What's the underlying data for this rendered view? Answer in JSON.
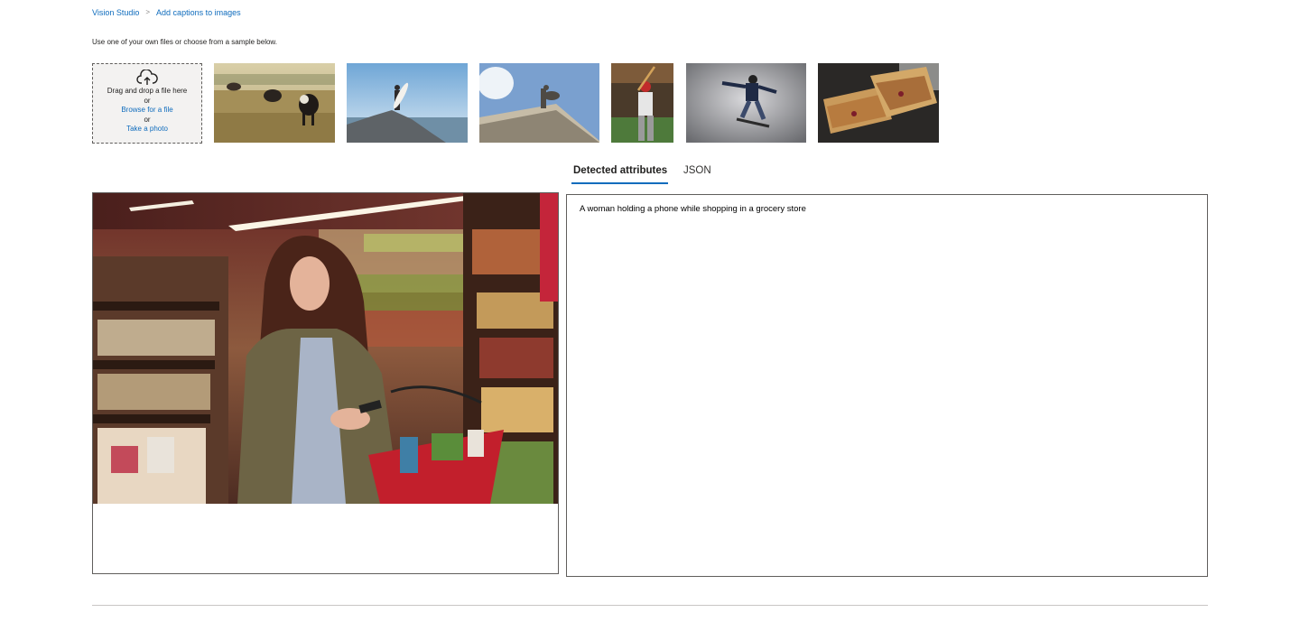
{
  "breadcrumb": {
    "root": "Vision Studio",
    "current": "Add captions to images"
  },
  "instruction": "Use one of your own files or choose from a sample below.",
  "upload": {
    "drag_text": "Drag and drop a file here",
    "or_1": "or",
    "browse_link": "Browse for a file",
    "or_2": "or",
    "photo_link": "Take a photo",
    "icon": "cloud-upload-icon"
  },
  "samples": [
    {
      "name": "cows grazing in field"
    },
    {
      "name": "surfer standing on rocks"
    },
    {
      "name": "building statue rooftop"
    },
    {
      "name": "baseball batter"
    },
    {
      "name": "skateboarder jumping"
    },
    {
      "name": "grilled sandwich"
    }
  ],
  "tabs": {
    "detected": "Detected attributes",
    "json": "JSON",
    "active": "Detected attributes"
  },
  "result": {
    "caption": "A woman holding a phone while shopping in a grocery store"
  },
  "colors": {
    "link": "#0f6cbd",
    "border": "#605e5c",
    "upload_bg": "#f3f2f1"
  }
}
